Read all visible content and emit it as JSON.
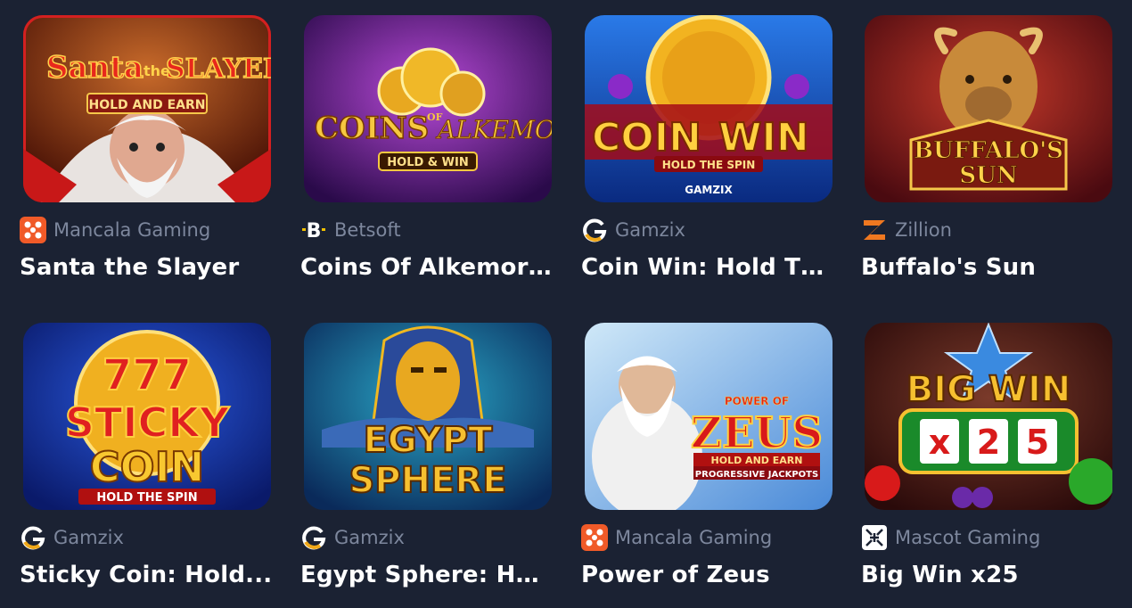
{
  "games": [
    {
      "provider": "Mancala Gaming",
      "provider_icon": "mancala-icon",
      "title": "Santa the Slayer",
      "art": [
        "Santa",
        "the",
        "SLAYER",
        "HOLD AND EARN"
      ]
    },
    {
      "provider": "Betsoft",
      "provider_icon": "betsoft-icon",
      "title": "Coins Of Alkemor ...",
      "art": [
        "COINS",
        "OF",
        "ALKEMOR",
        "HOLD & WIN"
      ]
    },
    {
      "provider": "Gamzix",
      "provider_icon": "gamzix-icon",
      "title": "Coin Win: Hold Th...",
      "art": [
        "COIN",
        "WIN",
        "HOLD THE SPIN",
        "GAMZIX"
      ]
    },
    {
      "provider": "Zillion",
      "provider_icon": "zillion-icon",
      "title": "Buffalo's Sun",
      "art": [
        "BUFFALO'S",
        "SUN"
      ]
    },
    {
      "provider": "Gamzix",
      "provider_icon": "gamzix-icon",
      "title": "Sticky Coin: Hold...",
      "art": [
        "777",
        "STICKY",
        "COIN",
        "HOLD THE SPIN"
      ]
    },
    {
      "provider": "Gamzix",
      "provider_icon": "gamzix-icon",
      "title": "Egypt Sphere: Hol...",
      "art": [
        "EGYPT",
        "SPHERE"
      ]
    },
    {
      "provider": "Mancala Gaming",
      "provider_icon": "mancala-icon",
      "title": "Power of Zeus",
      "art": [
        "POWER OF",
        "ZEUS",
        "HOLD AND EARN",
        "PROGRESSIVE JACKPOTS"
      ]
    },
    {
      "provider": "Mascot Gaming",
      "provider_icon": "mascot-icon",
      "title": "Big Win x25",
      "art": [
        "BIG WIN",
        "x",
        "2",
        "5"
      ]
    }
  ],
  "colors": {
    "background": "#1b2233",
    "provider_text": "#7d879d",
    "title_text": "#ffffff"
  }
}
